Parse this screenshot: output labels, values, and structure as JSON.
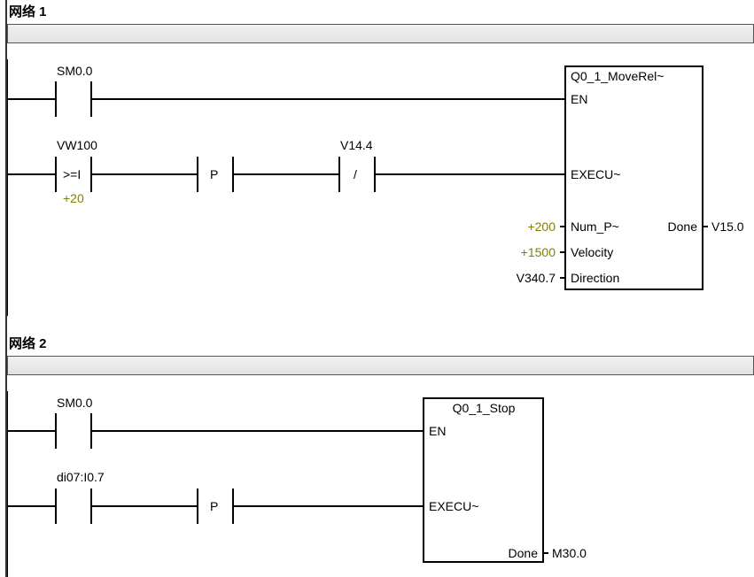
{
  "network1": {
    "title": "网络 1",
    "rung1": {
      "contact1_label": "SM0.0"
    },
    "rung2": {
      "contact1_label": "VW100",
      "contact1_op": ">=I",
      "contact1_const": "+20",
      "pulse_label": "P",
      "contact3_label": "V14.4",
      "contact3_type": "/"
    },
    "block": {
      "title": "Q0_1_MoveRel~",
      "in_en": "EN",
      "in_execu": "EXECU~",
      "in_nump_label": "Num_P~",
      "in_nump_val": "+200",
      "in_velocity_label": "Velocity",
      "in_velocity_val": "+1500",
      "in_direction_label": "Direction",
      "in_direction_val": "V340.7",
      "out_done_label": "Done",
      "out_done_val": "V15.0"
    }
  },
  "network2": {
    "title": "网络 2",
    "rung1": {
      "contact1_label": "SM0.0"
    },
    "rung2": {
      "contact1_label": "di07:I0.7",
      "pulse_label": "P"
    },
    "block": {
      "title": "Q0_1_Stop",
      "in_en": "EN",
      "in_execu": "EXECU~",
      "out_done_label": "Done",
      "out_done_val": "M30.0"
    }
  }
}
